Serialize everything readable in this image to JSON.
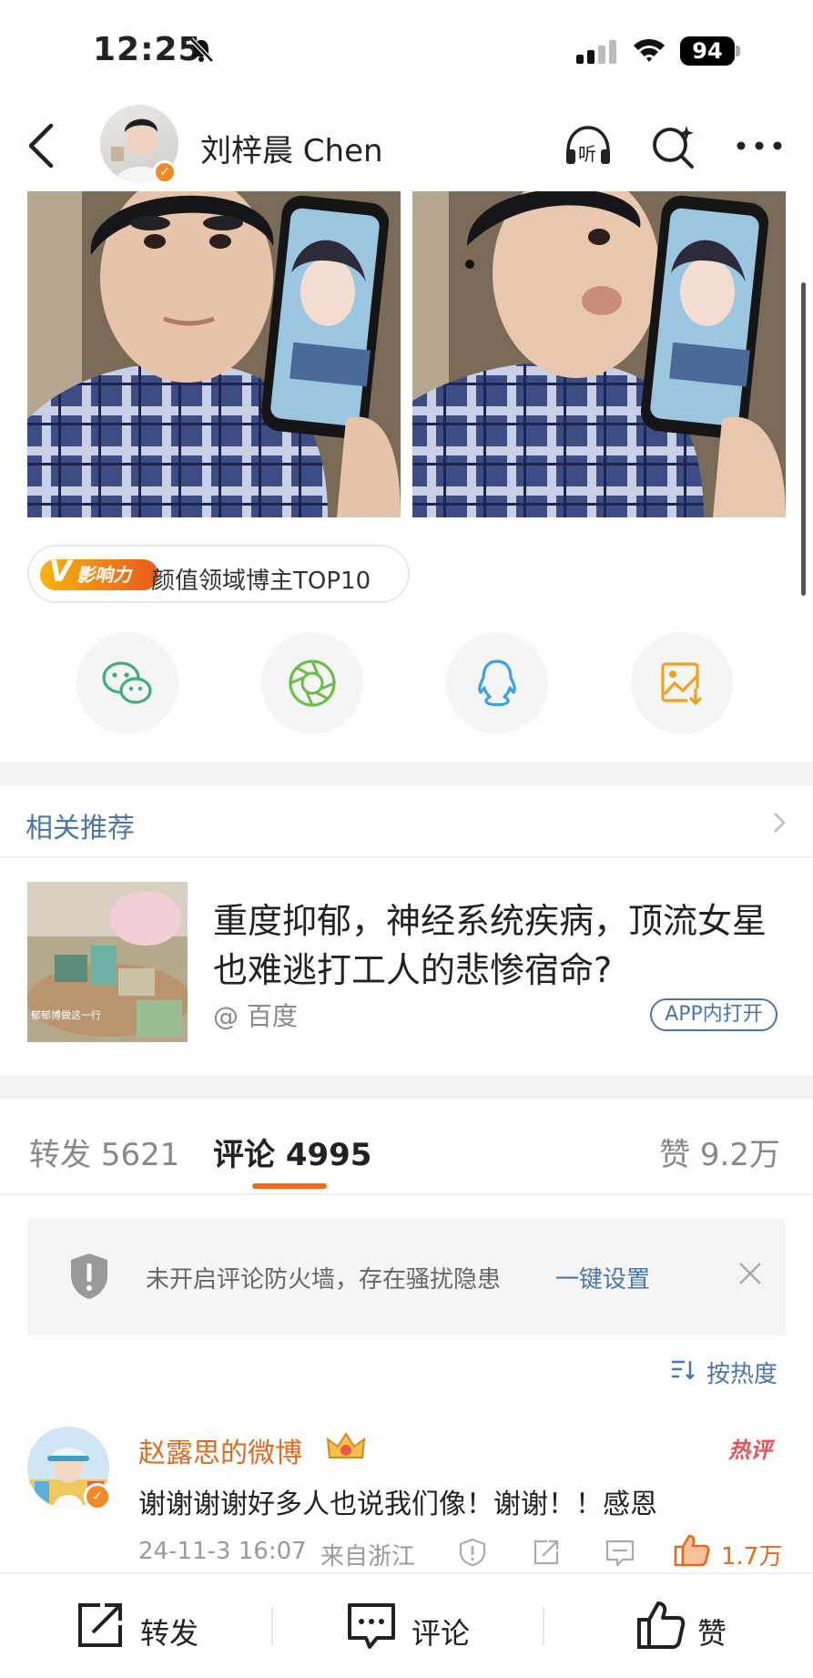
{
  "status_bar": {
    "time": "12:25",
    "battery": "94"
  },
  "nav": {
    "title": "刘梓晨 Chen",
    "icons": [
      "back-icon",
      "listen-icon",
      "magic-search-icon",
      "more-icon"
    ],
    "listen_label": "听"
  },
  "influence_badge": {
    "logo_text": "影响力",
    "text": "颜值领域博主TOP10"
  },
  "share_targets": [
    "wechat-icon",
    "moments-icon",
    "qq-icon",
    "save-image-icon"
  ],
  "related": {
    "header": "相关推荐",
    "title": "重度抑郁，神经系统疾病，顶流女星也难逃打工人的悲惨宿命?",
    "source": "@ 百度",
    "open_in_app": "APP内打开",
    "thumb_caption": "郁郁博做这一行"
  },
  "tabs": {
    "repost": "转发 5621",
    "comments": "评论 4995",
    "likes": "赞 9.2万"
  },
  "firewall": {
    "text": "未开启评论防火墙，存在骚扰隐患",
    "link": "一键设置"
  },
  "sort": {
    "label": "按热度"
  },
  "comment": {
    "username": "赵露思的微博",
    "hot_badge": "热评",
    "text": "谢谢谢谢好多人也说我们像！谢谢！！感恩",
    "timestamp": "24-11-3 16:07",
    "location": "来自浙江",
    "likes": "1.7万"
  },
  "bottom_bar": {
    "repost": "转发",
    "comment": "评论",
    "like": "赞"
  },
  "colors": {
    "accent": "#e06b1f",
    "link": "#4a77a8",
    "hot": "#e8505b"
  }
}
